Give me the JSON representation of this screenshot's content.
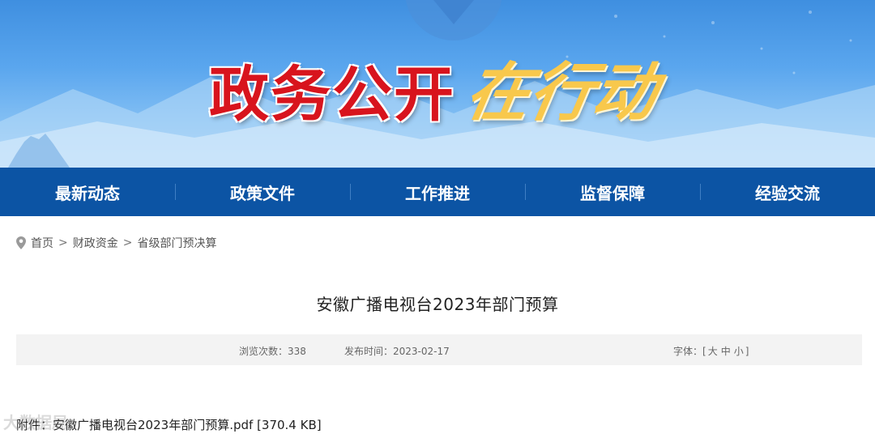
{
  "banner": {
    "title_main": "政务公开",
    "title_accent": "在行动"
  },
  "nav": {
    "items": [
      {
        "label": "最新动态"
      },
      {
        "label": "政策文件"
      },
      {
        "label": "工作推进"
      },
      {
        "label": "监督保障"
      },
      {
        "label": "经验交流"
      }
    ]
  },
  "breadcrumb": {
    "items": [
      "首页",
      "财政资金",
      "省级部门预决算"
    ],
    "separator": ">"
  },
  "article": {
    "title": "安徽广播电视台2023年部门预算",
    "views_label": "浏览次数：338",
    "date_label": "发布时间：2023-02-17",
    "font_label": "字体：[",
    "font_sizes": [
      "大",
      "中",
      "小"
    ],
    "font_close": "]",
    "attachment_prefix": "附件：",
    "attachment_name": "安徽广播电视台2023年部门预算.pdf [370.4 KB]"
  },
  "watermark": "大数据局",
  "colors": {
    "nav_bg": "#0c54a4",
    "title_red": "#d8141d",
    "title_gold": "#f8c84c"
  }
}
